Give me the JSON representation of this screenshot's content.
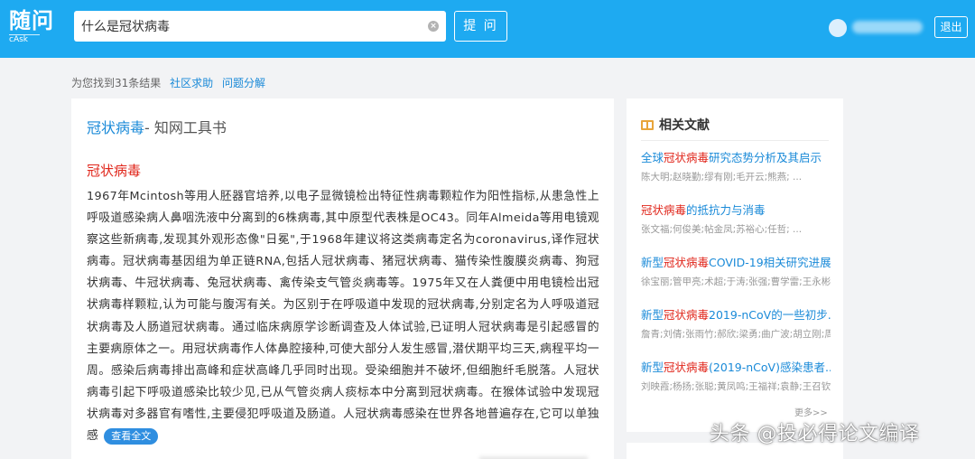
{
  "header": {
    "logo_main": "随问",
    "logo_sub": "cAsk",
    "search_value": "什么是冠状病毒",
    "ask_label": "提 问",
    "logout_label": "退出"
  },
  "results": {
    "summary": "为您找到31条结果",
    "link1": "社区求助",
    "link2": "问题分解"
  },
  "main": {
    "title_keyword": "冠状病毒",
    "title_source": "- 知网工具书",
    "entry_title": "冠状病毒",
    "entry_body": "1967年Mcintosh等用人胚器官培养,以电子显微镜检出特征性病毒颗粒作为阳性指标,从患急性上呼吸道感染病人鼻咽洗液中分离到的6株病毒,其中原型代表株是OC43。同年Almeida等用电镜观察这些新病毒,发现其外观形态像\"日冕\",于1968年建议将这类病毒定名为coronavirus,译作冠状病毒。冠状病毒基因组为单正链RNA,包括人冠状病毒、猪冠状病毒、猫传染性腹膜炎病毒、狗冠状病毒、牛冠状病毒、兔冠状病毒、禽传染支气管炎病毒等。1975年又在人粪便中用电镜检出冠状病毒样颗粒,认为可能与腹泻有关。为区别于在呼吸道中发现的冠状病毒,分别定名为人呼吸道冠状病毒及人肠道冠状病毒。通过临床病原学诊断调查及人体试验,已证明人冠状病毒是引起感冒的主要病原体之一。用冠状病毒作人体鼻腔接种,可使大部分人发生感冒,潜伏期平均三天,病程平均一周。感染后病毒排出高峰和症状高峰几乎同时出现。受染细胞并不破坏,但细胞纤毛脱落。人冠状病毒引起下呼吸道感染比较少见,已从气管炎病人痰标本中分离到冠状病毒。在猴体试验中发现冠状病毒对多器官有嗜性,主要侵犯呼吸道及肠道。人冠状病毒感染在世界各地普遍存在,它可以单独感",
    "view_full_label": "查看全文"
  },
  "sidebar": {
    "header": "相关文献",
    "items": [
      {
        "pre": "全球",
        "hl": "冠状病毒",
        "post": "研究态势分析及其启示",
        "authors": "陈大明;赵晓勤;缪有刚;毛开云;熊燕;  ..."
      },
      {
        "pre": "",
        "hl": "冠状病毒",
        "post": "的抵抗力与消毒",
        "authors": "张文福;何俊美;帖金凤;苏裕心;任哲;  ..."
      },
      {
        "pre": "新型",
        "hl": "冠状病毒",
        "post": "COVID-19相关研究进展",
        "authors": "徐宝丽;管甲亮;术超;于涛;张强;曹学雷;王永彬;周"
      },
      {
        "pre": "新型",
        "hl": "冠状病毒",
        "post": "2019-nCoV的一些初步...",
        "authors": "詹青;刘倩;张雨竹;郝欣;梁勇;曲广波;胡立刚;周"
      },
      {
        "pre": "新型",
        "hl": "冠状病毒",
        "post": "(2019-nCoV)感染患者...",
        "authors": "刘映霞;杨扬;张聪;黄凤鸣;王福祥;袁静;王召钦;李"
      }
    ],
    "more_label": "更多>>"
  },
  "watermark": "头条 @投必得论文编译"
}
